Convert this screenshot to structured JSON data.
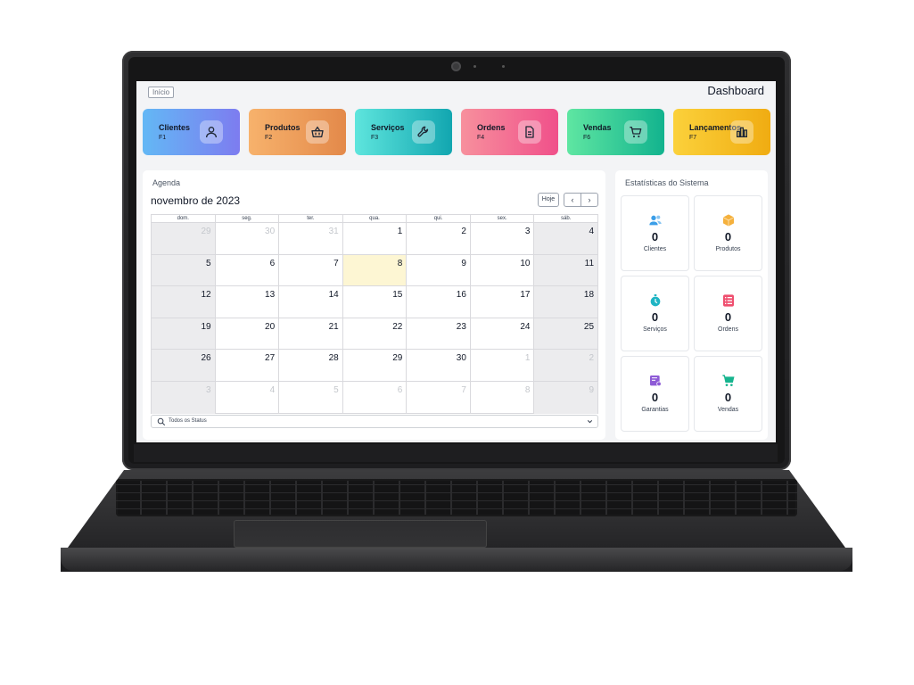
{
  "header": {
    "inicio_label": "Início",
    "title": "Dashboard"
  },
  "tiles": [
    {
      "label": "Clientes",
      "shortcut": "F1",
      "icon": "user-icon",
      "gradient": [
        "#63b8f5",
        "#7d7cf0"
      ]
    },
    {
      "label": "Produtos",
      "shortcut": "F2",
      "icon": "basket-icon",
      "gradient": [
        "#f7b26c",
        "#e3894a"
      ]
    },
    {
      "label": "Serviços",
      "shortcut": "F3",
      "icon": "wrench-icon",
      "gradient": [
        "#5ee5dd",
        "#12a6b0"
      ]
    },
    {
      "label": "Ordens",
      "shortcut": "F4",
      "icon": "document-icon",
      "gradient": [
        "#f7909d",
        "#f0508a"
      ]
    },
    {
      "label": "Vendas",
      "shortcut": "F6",
      "icon": "cart-icon",
      "gradient": [
        "#5fe6a2",
        "#12b38e"
      ]
    },
    {
      "label": "Lançamentos",
      "shortcut": "F7",
      "icon": "bar-chart-icon",
      "gradient": [
        "#fbd13b",
        "#f0ac12"
      ]
    }
  ],
  "agenda": {
    "title": "Agenda",
    "month": "novembro de 2023",
    "today_label": "Hoje",
    "prev_icon": "chevron-left-icon",
    "next_icon": "chevron-right-icon",
    "weekdays": [
      "dom.",
      "seg.",
      "ter.",
      "qua.",
      "qui.",
      "sex.",
      "sáb."
    ],
    "weeks": [
      [
        {
          "d": "29",
          "o": true
        },
        {
          "d": "30",
          "o": true
        },
        {
          "d": "31",
          "o": true
        },
        {
          "d": "1"
        },
        {
          "d": "2"
        },
        {
          "d": "3"
        },
        {
          "d": "4"
        }
      ],
      [
        {
          "d": "5"
        },
        {
          "d": "6"
        },
        {
          "d": "7"
        },
        {
          "d": "8",
          "today": true
        },
        {
          "d": "9"
        },
        {
          "d": "10"
        },
        {
          "d": "11"
        }
      ],
      [
        {
          "d": "12"
        },
        {
          "d": "13"
        },
        {
          "d": "14"
        },
        {
          "d": "15"
        },
        {
          "d": "16"
        },
        {
          "d": "17"
        },
        {
          "d": "18"
        }
      ],
      [
        {
          "d": "19"
        },
        {
          "d": "20"
        },
        {
          "d": "21"
        },
        {
          "d": "22"
        },
        {
          "d": "23"
        },
        {
          "d": "24"
        },
        {
          "d": "25"
        }
      ],
      [
        {
          "d": "26"
        },
        {
          "d": "27"
        },
        {
          "d": "28"
        },
        {
          "d": "29"
        },
        {
          "d": "30"
        },
        {
          "d": "1",
          "o": true
        },
        {
          "d": "2",
          "o": true
        }
      ],
      [
        {
          "d": "3",
          "o": true
        },
        {
          "d": "4",
          "o": true
        },
        {
          "d": "5",
          "o": true
        },
        {
          "d": "6",
          "o": true
        },
        {
          "d": "7",
          "o": true
        },
        {
          "d": "8",
          "o": true
        },
        {
          "d": "9",
          "o": true
        }
      ]
    ],
    "status_filter": "Todos os Status"
  },
  "stats": {
    "title": "Estatísticas do Sistema",
    "items": [
      {
        "label": "Clientes",
        "value": "0",
        "icon": "users-icon",
        "color": "#3b9ee8"
      },
      {
        "label": "Produtos",
        "value": "0",
        "icon": "box-icon",
        "color": "#f5b13d"
      },
      {
        "label": "Serviços",
        "value": "0",
        "icon": "stopwatch-icon",
        "color": "#1fb5c4"
      },
      {
        "label": "Ordens",
        "value": "0",
        "icon": "list-icon",
        "color": "#ef4f6f"
      },
      {
        "label": "Garantias",
        "value": "0",
        "icon": "certificate-icon",
        "color": "#8e5bd6"
      },
      {
        "label": "Vendas",
        "value": "0",
        "icon": "cart-icon",
        "color": "#17b48e"
      }
    ]
  }
}
